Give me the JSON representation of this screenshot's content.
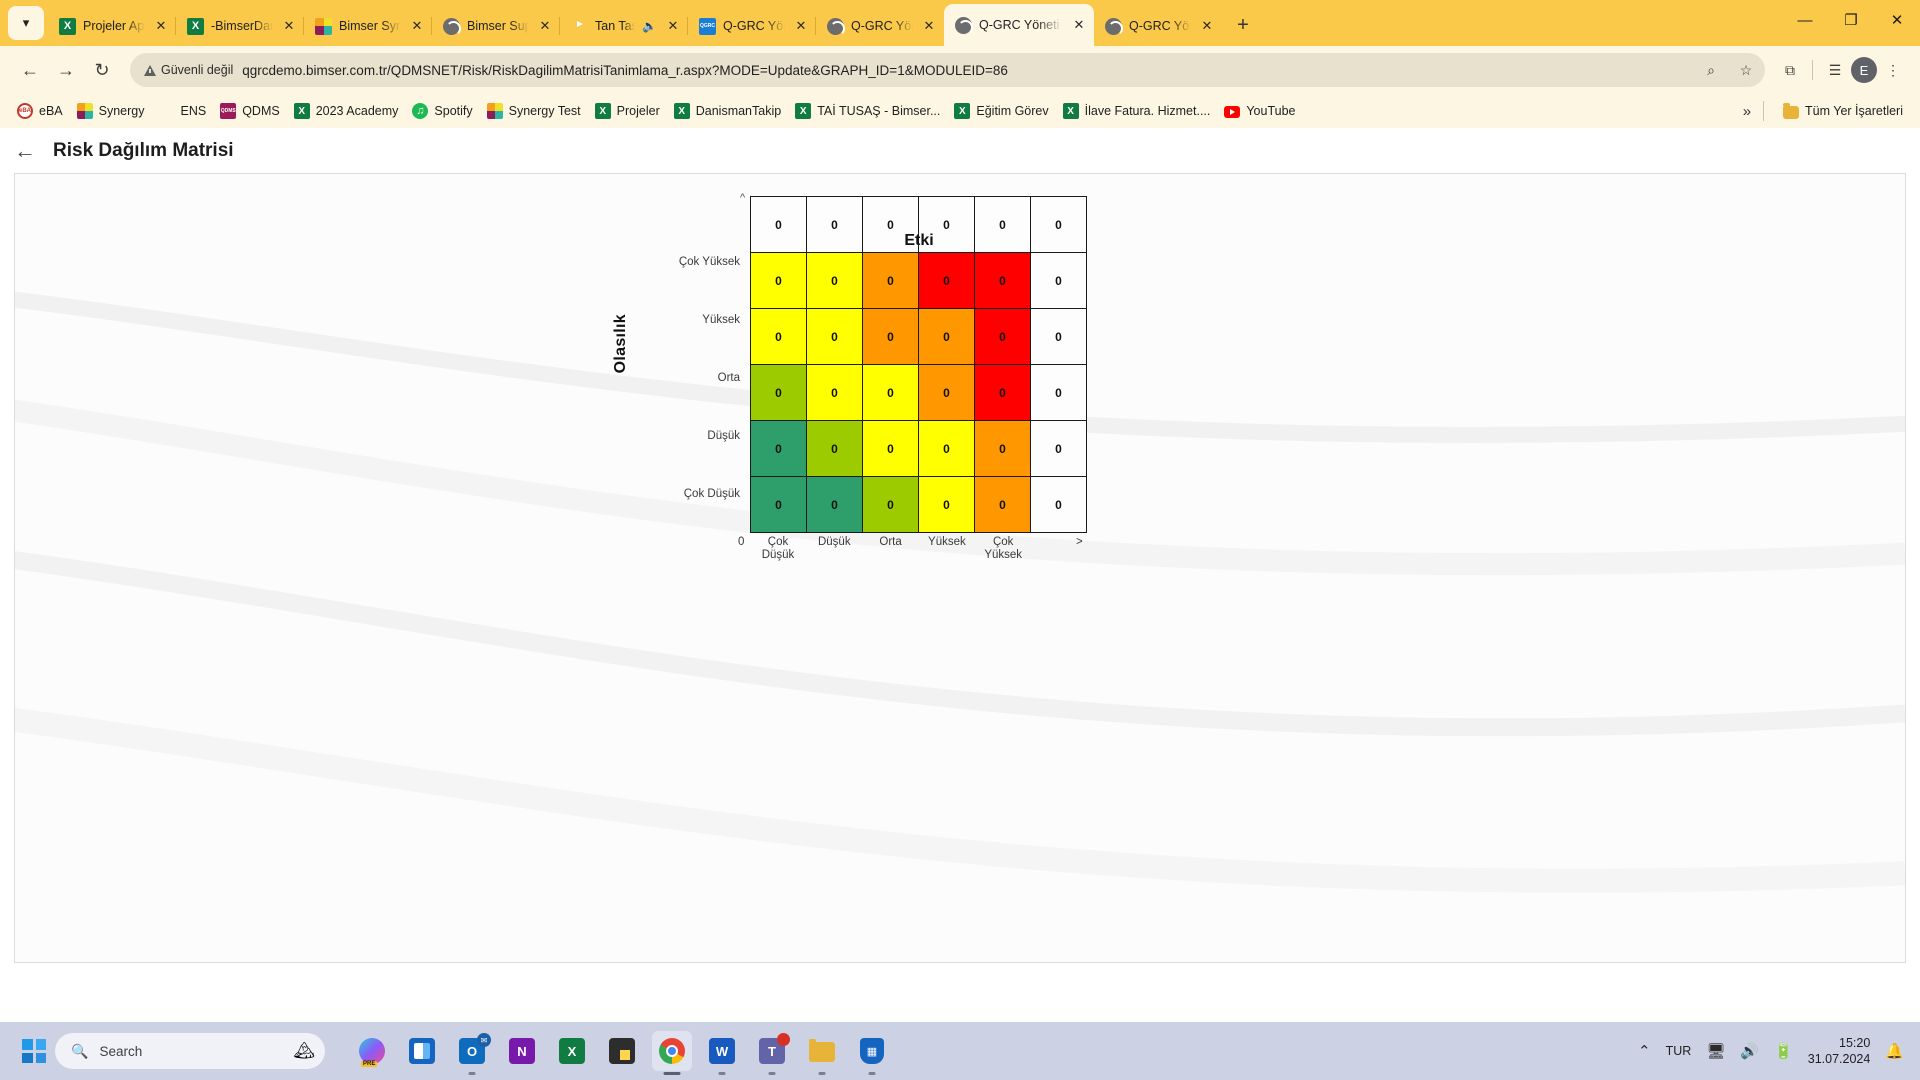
{
  "browser": {
    "tabs": [
      {
        "title": "Projeler Appli",
        "icon": "excel-icon",
        "active": false,
        "audio": false
      },
      {
        "title": "-BimserDanis",
        "icon": "excel-icon",
        "active": false,
        "audio": false
      },
      {
        "title": "Bimser Synerg",
        "icon": "synergy-icon",
        "active": false,
        "audio": false
      },
      {
        "title": "Bimser Suppo",
        "icon": "globe-icon",
        "active": false,
        "audio": false
      },
      {
        "title": "Tan Taşçı",
        "icon": "youtube-icon",
        "active": false,
        "audio": true
      },
      {
        "title": "Q-GRC Yöneti",
        "icon": "qgrc-icon",
        "active": false,
        "audio": false
      },
      {
        "title": "Q-GRC Yöneti",
        "icon": "globe-icon",
        "active": false,
        "audio": false
      },
      {
        "title": "Q-GRC Yöneti",
        "icon": "globe-icon",
        "active": true,
        "audio": false
      },
      {
        "title": "Q-GRC Yöneti",
        "icon": "globe-icon",
        "active": false,
        "audio": false
      }
    ],
    "new_tab_label": "+",
    "window_controls": {
      "minimize": "—",
      "maximize": "❐",
      "close": "✕"
    },
    "toolbar": {
      "back": "←",
      "forward": "→",
      "reload": "↻",
      "security_label": "Güvenli değil",
      "url": "qgrcdemo.bimser.com.tr/QDMSNET/Risk/RiskDagilimMatrisiTanimlama_r.aspx?MODE=Update&GRAPH_ID=1&MODULEID=86",
      "zoom_icon": "⌕",
      "bookmark_star": "☆",
      "extensions_icon": "⧉",
      "reading_list_icon": "☰",
      "profile_initial": "E",
      "menu_icon": "⋮"
    },
    "bookmarks": [
      {
        "label": "eBA",
        "icon": "eba-icon"
      },
      {
        "label": "Synergy",
        "icon": "synergy-icon"
      },
      {
        "label": "ENS",
        "icon": "ens-icon"
      },
      {
        "label": "QDMS",
        "icon": "qdms-icon"
      },
      {
        "label": "2023 Academy",
        "icon": "excel-icon"
      },
      {
        "label": "Spotify",
        "icon": "spotify-icon"
      },
      {
        "label": "Synergy Test",
        "icon": "synergy-icon"
      },
      {
        "label": "Projeler",
        "icon": "excel-icon"
      },
      {
        "label": "DanismanTakip",
        "icon": "excel-icon"
      },
      {
        "label": "TAİ TUSAŞ - Bimser...",
        "icon": "excel-icon"
      },
      {
        "label": "Eğitim Görev",
        "icon": "excel-icon"
      },
      {
        "label": "İlave Fatura. Hizmet....",
        "icon": "excel-icon"
      },
      {
        "label": "YouTube",
        "icon": "youtube-icon"
      }
    ],
    "bookmarks_overflow": "»",
    "all_bookmarks_label": "Tüm Yer İşaretleri",
    "all_bookmarks_icon": "folder-icon"
  },
  "page": {
    "back_arrow": "←",
    "title": "Risk Dağılım Matrisi"
  },
  "chart_data": {
    "type": "heatmap",
    "title": "Risk Dağılım Matrisi",
    "xlabel": "Etki",
    "ylabel": "Olasılık",
    "x_origin_label": "0",
    "x_end_label": ">",
    "y_caret_label": "^",
    "xtick_labels": [
      "Çok Düşük",
      "Düşük",
      "Orta",
      "Yüksek",
      "Çok Yüksek",
      ""
    ],
    "ytick_labels": [
      "",
      "Çok Yüksek",
      "Yüksek",
      "Orta",
      "Düşük",
      "Çok Düşük"
    ],
    "colors": {
      "green": "#2e9e6b",
      "lightgreen": "#9ccc00",
      "yellow": "#ffff00",
      "orange": "#ff9800",
      "red": "#ff0000",
      "empty": "#fdfdfd"
    },
    "rows": [
      {
        "label": "",
        "cells": [
          {
            "value": "0",
            "color": "empty"
          },
          {
            "value": "0",
            "color": "empty"
          },
          {
            "value": "0",
            "color": "empty"
          },
          {
            "value": "0",
            "color": "empty"
          },
          {
            "value": "0",
            "color": "empty"
          },
          {
            "value": "0",
            "color": "empty"
          }
        ]
      },
      {
        "label": "Çok Yüksek",
        "cells": [
          {
            "value": "0",
            "color": "yellow"
          },
          {
            "value": "0",
            "color": "yellow"
          },
          {
            "value": "0",
            "color": "orange"
          },
          {
            "value": "0",
            "color": "red"
          },
          {
            "value": "0",
            "color": "red"
          },
          {
            "value": "0",
            "color": "empty"
          }
        ]
      },
      {
        "label": "Yüksek",
        "cells": [
          {
            "value": "0",
            "color": "yellow"
          },
          {
            "value": "0",
            "color": "yellow"
          },
          {
            "value": "0",
            "color": "orange"
          },
          {
            "value": "0",
            "color": "orange"
          },
          {
            "value": "0",
            "color": "red"
          },
          {
            "value": "0",
            "color": "empty"
          }
        ]
      },
      {
        "label": "Orta",
        "cells": [
          {
            "value": "0",
            "color": "lightgreen"
          },
          {
            "value": "0",
            "color": "yellow"
          },
          {
            "value": "0",
            "color": "yellow"
          },
          {
            "value": "0",
            "color": "orange"
          },
          {
            "value": "0",
            "color": "red"
          },
          {
            "value": "0",
            "color": "empty"
          }
        ]
      },
      {
        "label": "Düşük",
        "cells": [
          {
            "value": "0",
            "color": "green"
          },
          {
            "value": "0",
            "color": "lightgreen"
          },
          {
            "value": "0",
            "color": "yellow"
          },
          {
            "value": "0",
            "color": "yellow"
          },
          {
            "value": "0",
            "color": "orange"
          },
          {
            "value": "0",
            "color": "empty"
          }
        ]
      },
      {
        "label": "Çok Düşük",
        "cells": [
          {
            "value": "0",
            "color": "green"
          },
          {
            "value": "0",
            "color": "green"
          },
          {
            "value": "0",
            "color": "lightgreen"
          },
          {
            "value": "0",
            "color": "yellow"
          },
          {
            "value": "0",
            "color": "orange"
          },
          {
            "value": "0",
            "color": "empty"
          }
        ]
      }
    ]
  },
  "taskbar": {
    "start_icon": "windows-icon",
    "search_placeholder": "Search",
    "search_icon": "search-icon",
    "apps": [
      {
        "name": "copilot-pre-icon",
        "active": false,
        "running": false
      },
      {
        "name": "task-view-icon",
        "active": false,
        "running": false
      },
      {
        "name": "outlook-icon",
        "active": false,
        "running": true
      },
      {
        "name": "onenote-icon",
        "active": false,
        "running": false
      },
      {
        "name": "excel-icon",
        "active": false,
        "running": false
      },
      {
        "name": "sticky-notes-icon",
        "active": false,
        "running": false
      },
      {
        "name": "chrome-icon",
        "active": true,
        "running": true
      },
      {
        "name": "word-icon",
        "active": false,
        "running": true
      },
      {
        "name": "teams-icon",
        "active": false,
        "running": true
      },
      {
        "name": "file-explorer-icon",
        "active": false,
        "running": true
      },
      {
        "name": "security-icon",
        "active": false,
        "running": true
      }
    ],
    "tray": {
      "overflow_icon": "⌃",
      "language": "TUR",
      "network_icon": "network-icon",
      "volume_icon": "🔊",
      "battery_icon": "battery-icon",
      "time": "15:20",
      "date": "31.07.2024",
      "notification_icon": "🔔"
    }
  }
}
